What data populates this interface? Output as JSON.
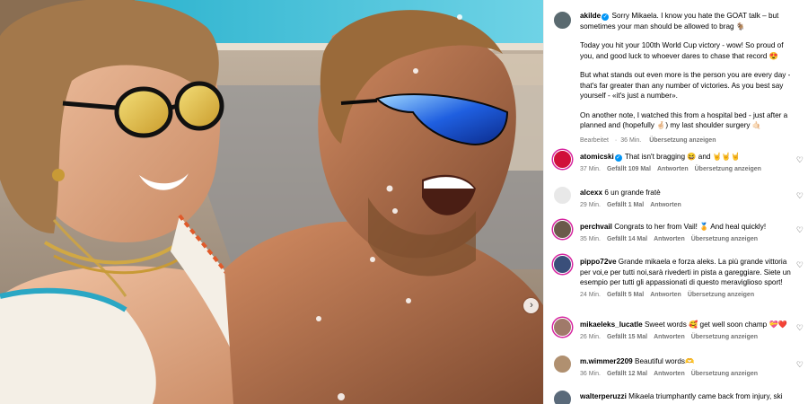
{
  "caption": {
    "username": "akilde",
    "lines": [
      "Sorry Mikaela. I know you hate the GOAT talk – but sometimes your man should be allowed to brag 🐐",
      "Today you hit your 100th World Cup victory - wow! So proud of you, and good luck to whoever dares to chase that record 😍",
      "But what stands out even more is the person you are every day - that's far greater than any number of victories. As you best say yourself - «it's just a number».",
      "On another note, I watched this from a hospital bed - just after a planned and (hopefully 🤞🏻) my last shoulder surgery 🤙🏻"
    ],
    "edited": "Bearbeitet",
    "time": "36 Min.",
    "translate": "Übersetzung anzeigen"
  },
  "comments": [
    {
      "username": "atomicski",
      "verified": true,
      "text": "That isn't bragging 😆 and 🤘🤘🤘",
      "time": "37 Min.",
      "likes": "Gefällt 109 Mal",
      "reply": "Antworten",
      "translate": "Übersetzung anzeigen",
      "avatar_color": "#d0103a"
    },
    {
      "username": "alcexx",
      "verified": false,
      "text": "6 un grande fratè",
      "time": "29 Min.",
      "likes": "Gefällt 1 Mal",
      "reply": "Antworten",
      "translate": "",
      "avatar_color": "#e8e8e8"
    },
    {
      "username": "perchvail",
      "verified": false,
      "text": "Congrats to her from Vail! 🏅 And heal quickly!",
      "time": "35 Min.",
      "likes": "Gefällt 14 Mal",
      "reply": "Antworten",
      "translate": "Übersetzung anzeigen",
      "avatar_color": "#6b5a4a"
    },
    {
      "username": "pippo72ve",
      "verified": false,
      "text": "Grande mikaela e forza aleks. La più grande vittoria per voi,e per tutti noi,sarà rivederti in pista a gareggiare. Siete un esempio per tutti gli appassionati di questo meraviglioso sport!",
      "time": "24 Min.",
      "likes": "Gefällt 5 Mal",
      "reply": "Antworten",
      "translate": "Übersetzung anzeigen",
      "avatar_color": "#3a4f7a"
    },
    {
      "username": "mikaeleks_lucatle",
      "verified": false,
      "text": "Sweet words 🥰 get well soon champ 💝❤️",
      "time": "26 Min.",
      "likes": "Gefällt 15 Mal",
      "reply": "Antworten",
      "translate": "Übersetzung anzeigen",
      "avatar_color": "#a07a6a"
    },
    {
      "username": "m.wimmer2209",
      "verified": false,
      "text": "Beautiful words🫶",
      "time": "36 Min.",
      "likes": "Gefällt 12 Mal",
      "reply": "Antworten",
      "translate": "Übersetzung anzeigen",
      "avatar_color": "#b09070"
    },
    {
      "username": "walterperuzzi",
      "verified": false,
      "text": "Mikaela triumphantly came back from injury, ski",
      "time": "",
      "likes": "",
      "reply": "",
      "translate": "",
      "avatar_color": "#5a6a7a"
    }
  ],
  "media": {
    "next_icon": "chevron-right-icon"
  },
  "icons": {
    "like": "heart-outline-icon",
    "verified": "verified-badge-icon"
  },
  "colors": {
    "meta_gray": "#737373",
    "verified_blue": "#0095f6",
    "story_ring": "#d6249f"
  }
}
